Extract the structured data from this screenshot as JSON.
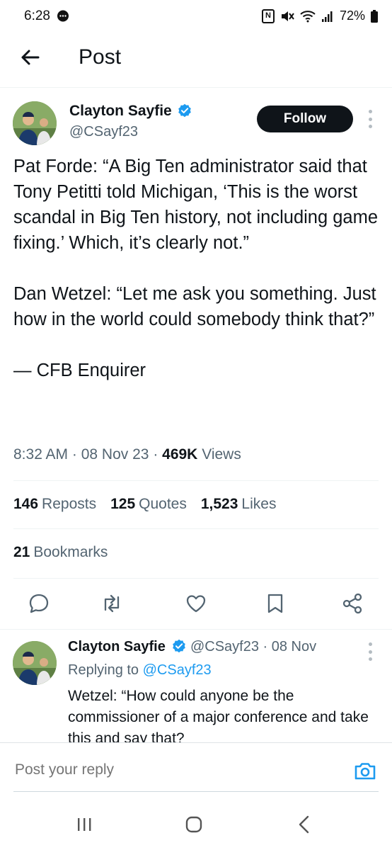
{
  "status_bar": {
    "time": "6:28",
    "battery": "72%",
    "icons": [
      "chat-bubble-icon",
      "nfc-icon",
      "mute-icon",
      "wifi-icon",
      "signal-icon",
      "battery-icon"
    ]
  },
  "header": {
    "title": "Post",
    "back_icon": "back-arrow-icon"
  },
  "post": {
    "author_name": "Clayton Sayfie",
    "handle": "@CSayf23",
    "verified": true,
    "follow_label": "Follow",
    "text": "Pat Forde: “A Big Ten administrator said that Tony Petitti told Michigan, ‘This is the worst scandal in Big Ten history, not including game fixing.’ Which, it’s clearly not.”\n\nDan Wetzel: “Let me ask you something. Just how in the world could somebody think that?”\n\n— CFB Enquirer",
    "time": "8:32 AM",
    "date": "08 Nov 23",
    "views_count": "469K",
    "views_label": "Views",
    "reposts_count": "146",
    "reposts_label": "Reposts",
    "quotes_count": "125",
    "quotes_label": "Quotes",
    "likes_count": "1,523",
    "likes_label": "Likes",
    "bookmarks_count": "21",
    "bookmarks_label": "Bookmarks",
    "actions": [
      "reply-icon",
      "repost-icon",
      "like-icon",
      "bookmark-icon",
      "share-icon"
    ]
  },
  "reply": {
    "author_name": "Clayton Sayfie",
    "handle": "@CSayf23",
    "date": "08 Nov",
    "replying_prefix": "Replying to",
    "replying_to": "@CSayf23",
    "text": "Wetzel: “How could anyone be the commissioner of a major conference and take this and say that?"
  },
  "compose": {
    "placeholder": "Post your reply",
    "camera_icon": "camera-icon"
  },
  "colors": {
    "accent": "#1d9bf0",
    "text": "#0f1419",
    "secondary": "#536471",
    "follow_bg": "#0f1419"
  }
}
